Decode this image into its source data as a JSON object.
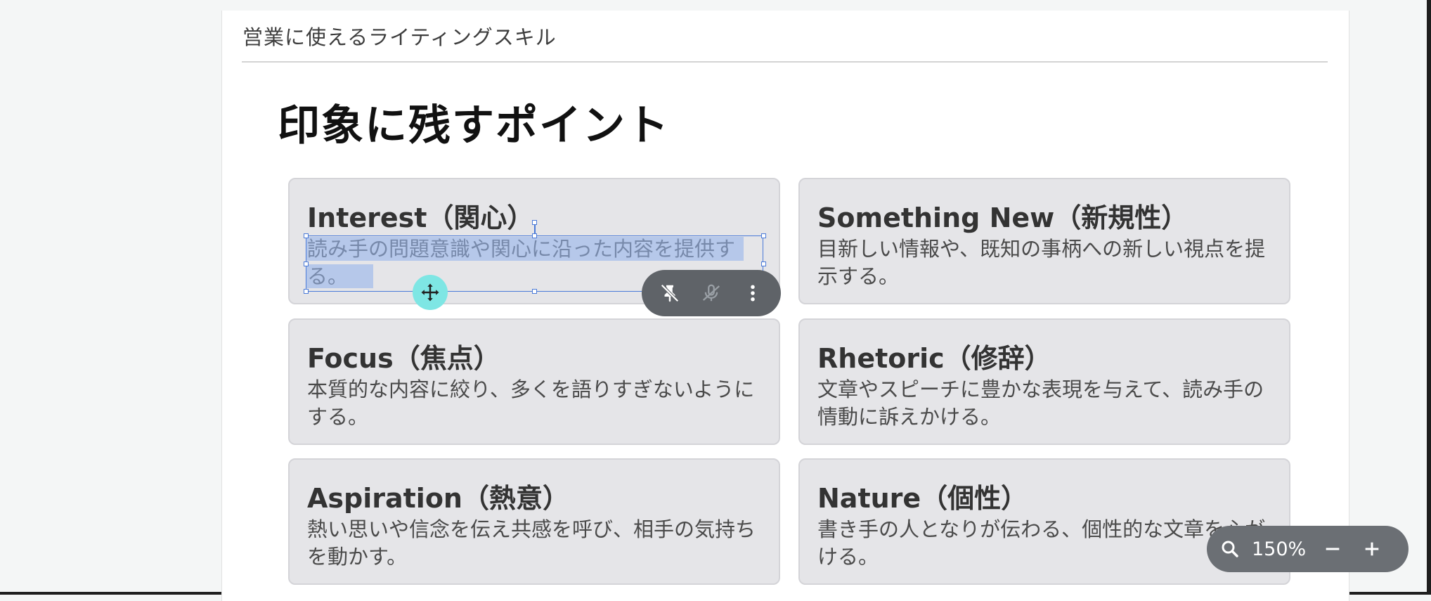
{
  "document": {
    "title": "営業に使えるライティングスキル"
  },
  "slide": {
    "heading": "印象に残すポイント",
    "cards": [
      {
        "title": "Interest（関心）",
        "body": "読み手の問題意識や関心に沿った内容を提供する。"
      },
      {
        "title": "Something New（新規性）",
        "body": "目新しい情報や、既知の事柄への新しい視点を提示する。"
      },
      {
        "title": "Focus（焦点）",
        "body": "本質的な内容に絞り、多くを語りすぎないようにする。"
      },
      {
        "title": "Rhetoric（修辞）",
        "body": "文章やスピーチに豊かな表現を与えて、読み手の情動に訴えかける。"
      },
      {
        "title": "Aspiration（熱意）",
        "body": "熱い思いや信念を伝え共感を呼び、相手の気持ちを動かす。"
      },
      {
        "title": "Nature（個性）",
        "body": "書き手の人となりが伝わる、個性的な文章を心がける。"
      }
    ]
  },
  "selection_toolbar": {
    "icons": [
      "pin-off-icon",
      "voice-off-icon",
      "more-vert-icon"
    ]
  },
  "zoom": {
    "level": "150%",
    "icons": [
      "zoom-search-icon",
      "zoom-out-icon",
      "zoom-in-icon"
    ]
  },
  "colors": {
    "card_bg": "#e5e5e8",
    "selection": "#4a7ad8",
    "move_handle": "#7ee6e4",
    "toolbar_bg": "#5f6368"
  }
}
